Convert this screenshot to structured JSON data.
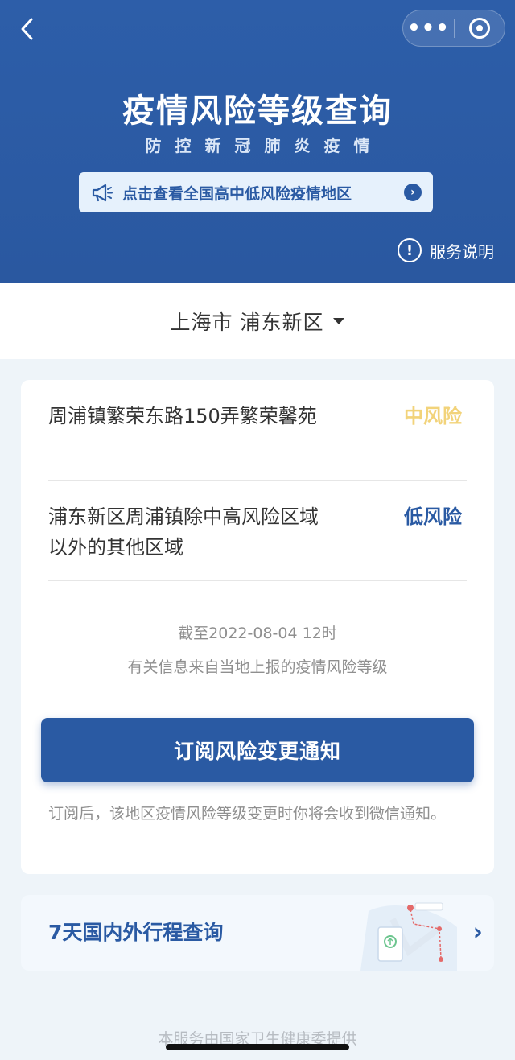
{
  "header": {
    "title": "疫情风险等级查询",
    "subtitle": "防控新冠肺炎疫情",
    "notice_text": "点击查看全国高中低风险疫情地区",
    "service_info_label": "服务说明",
    "more_icon": "more-dots-icon",
    "close_icon": "miniapp-close-icon"
  },
  "location": {
    "city": "上海市",
    "district": "浦东新区",
    "label": "上海市 浦东新区"
  },
  "risk_list": [
    {
      "area": "周浦镇繁荣东路150弄繁荣馨苑",
      "level": "中风险",
      "level_color": "#f2d37a"
    },
    {
      "area": "浦东新区周浦镇除中高风险区域以外的其他区域",
      "level": "低风险",
      "level_color": "#2a5aa3"
    }
  ],
  "update_time": "截至2022-08-04 12时",
  "source_note": "有关信息来自当地上报的疫情风险等级",
  "subscribe": {
    "button_label": "订阅风险变更通知",
    "tip": "订阅后，该地区疫情风险等级变更时你将会收到微信通知。"
  },
  "trip_query": {
    "label": "7天国内外行程查询"
  },
  "footer": "本服务由国家卫生健康委提供",
  "colors": {
    "primary": "#2a5aa3",
    "medium_risk": "#f2d37a",
    "low_risk": "#2a5aa3",
    "page_bg": "#eef4f9"
  }
}
